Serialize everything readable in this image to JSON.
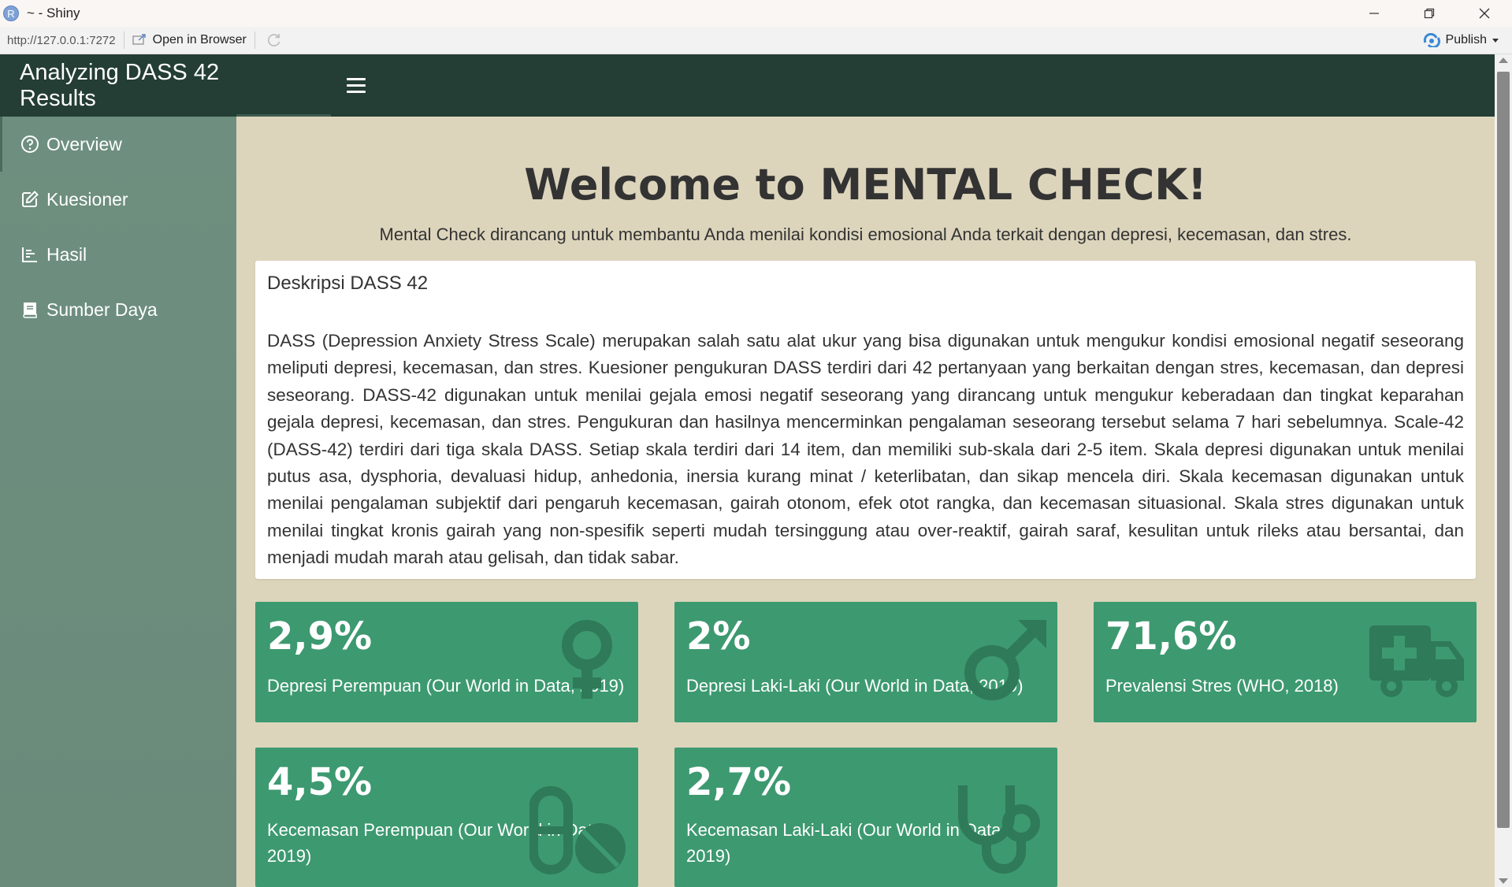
{
  "window": {
    "app_icon_letter": "R",
    "title": "~ - Shiny"
  },
  "toolbar": {
    "url": "http://127.0.0.1:7272",
    "open_in_browser": "Open in Browser",
    "publish": "Publish"
  },
  "header": {
    "brand": "Analyzing DASS 42 Results"
  },
  "sidebar": {
    "items": [
      {
        "label": "Overview",
        "icon": "question-circle-icon"
      },
      {
        "label": "Kuesioner",
        "icon": "edit-icon"
      },
      {
        "label": "Hasil",
        "icon": "chart-icon"
      },
      {
        "label": "Sumber Daya",
        "icon": "book-icon"
      }
    ]
  },
  "main": {
    "welcome": "Welcome to MENTAL CHECK!",
    "subtitle": "Mental Check dirancang untuk membantu Anda menilai kondisi emosional Anda terkait dengan depresi, kecemasan, dan stres.",
    "desc_title": "Deskripsi DASS 42",
    "desc_body": "DASS (Depression Anxiety Stress Scale) merupakan salah satu alat ukur yang bisa digunakan untuk mengukur kondisi emosional negatif seseorang meliputi depresi, kecemasan, dan stres. Kuesioner pengukuran DASS terdiri dari 42 pertanyaan yang berkaitan dengan stres, kecemasan, dan depresi seseorang. DASS-42 digunakan untuk menilai gejala emosi negatif seseorang yang dirancang untuk mengukur keberadaan dan tingkat keparahan gejala depresi, kecemasan, dan stres. Pengukuran dan hasilnya mencerminkan pengalaman seseorang tersebut selama 7 hari sebelumnya. Scale-42 (DASS-42) terdiri dari tiga skala DASS. Setiap skala terdiri dari 14 item, dan memiliki sub-skala dari 2-5 item. Skala depresi digunakan untuk menilai putus asa, dysphoria, devaluasi hidup, anhedonia, inersia kurang minat / keterlibatan, dan sikap mencela diri. Skala kecemasan digunakan untuk menilai pengalaman subjektif dari pengaruh kecemasan, gairah otonom, efek otot rangka, dan kecemasan situasional. Skala stres digunakan untuk menilai tingkat kronis gairah yang non-spesifik seperti mudah tersinggung atau over-reaktif, gairah saraf, kesulitan untuk rileks atau bersantai, dan menjadi mudah marah atau gelisah, dan tidak sabar.",
    "value_boxes": [
      {
        "value": "2,9%",
        "subtitle": "Depresi Perempuan (Our World in Data, 2019)",
        "icon": "venus-icon"
      },
      {
        "value": "2%",
        "subtitle": "Depresi Laki-Laki (Our World in Data, 2019)",
        "icon": "mars-icon"
      },
      {
        "value": "71,6%",
        "subtitle": "Prevalensi Stres (WHO, 2018)",
        "icon": "ambulance-icon"
      },
      {
        "value": "4,5%",
        "subtitle": "Kecemasan Perempuan (Our World in Data, 2019)",
        "icon": "pills-icon"
      },
      {
        "value": "2,7%",
        "subtitle": "Kecemasan Laki-Laki (Our World in Data, 2019)",
        "icon": "stethoscope-icon"
      }
    ]
  },
  "colors": {
    "header": "#243d35",
    "sidebar": "#6e8f7f",
    "content_bg": "#dcd5bc",
    "value_box": "#3d9970"
  }
}
